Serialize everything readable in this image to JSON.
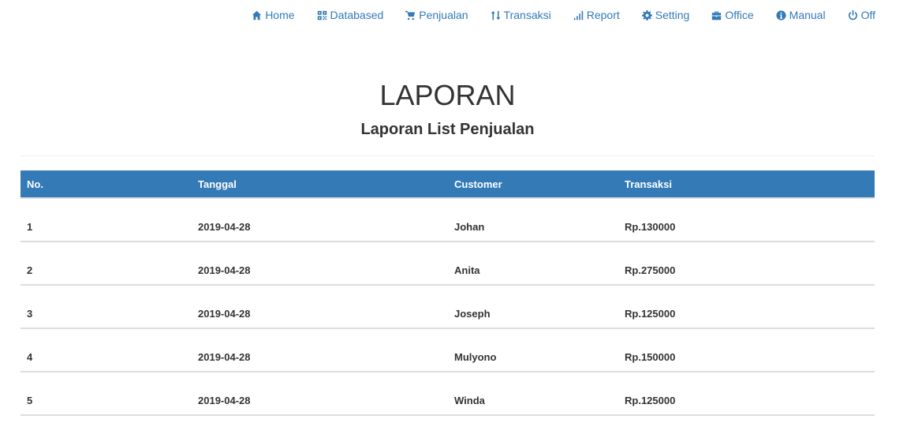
{
  "nav": {
    "items": [
      {
        "label": "Home",
        "icon": "home-icon"
      },
      {
        "label": "Databased",
        "icon": "qrcode-icon"
      },
      {
        "label": "Penjualan",
        "icon": "cart-icon"
      },
      {
        "label": "Transaksi",
        "icon": "sort-icon"
      },
      {
        "label": "Report",
        "icon": "signal-icon"
      },
      {
        "label": "Setting",
        "icon": "gear-icon"
      },
      {
        "label": "Office",
        "icon": "briefcase-icon"
      },
      {
        "label": "Manual",
        "icon": "info-icon"
      },
      {
        "label": "Off",
        "icon": "power-icon"
      }
    ],
    "color": "#337ab7"
  },
  "header": {
    "title": "LAPORAN",
    "subtitle": "Laporan List Penjualan"
  },
  "table": {
    "header_color": "#337ab7",
    "columns": [
      "No.",
      "Tanggal",
      "Customer",
      "Transaksi"
    ],
    "rows": [
      [
        "1",
        "2019-04-28",
        "Johan",
        "Rp.130000"
      ],
      [
        "2",
        "2019-04-28",
        "Anita",
        "Rp.275000"
      ],
      [
        "3",
        "2019-04-28",
        "Joseph",
        "Rp.125000"
      ],
      [
        "4",
        "2019-04-28",
        "Mulyono",
        "Rp.150000"
      ],
      [
        "5",
        "2019-04-28",
        "Winda",
        "Rp.125000"
      ]
    ]
  }
}
